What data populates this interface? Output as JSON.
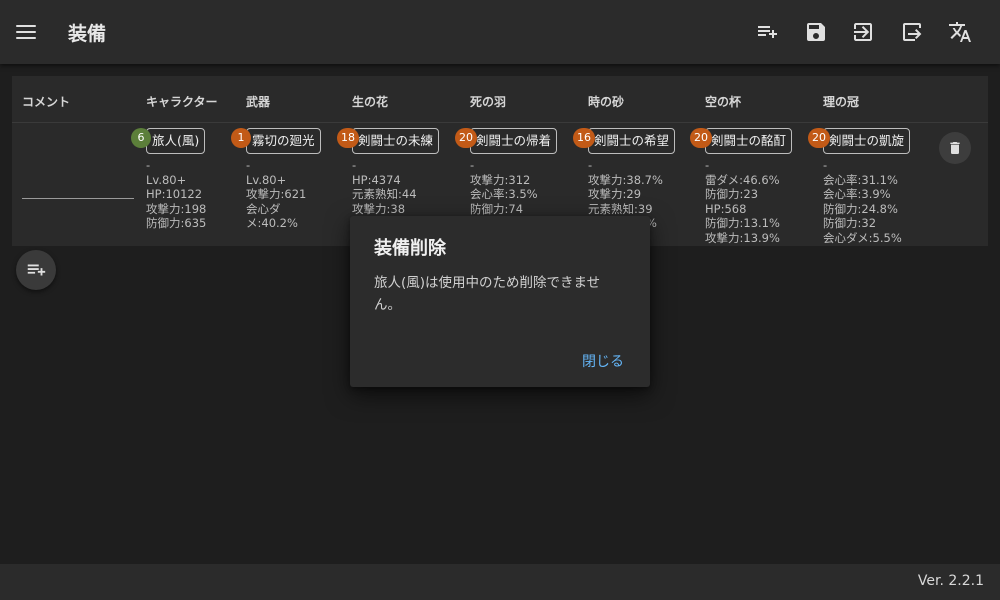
{
  "app": {
    "title": "装備",
    "version": "Ver. 2.2.1"
  },
  "toolbar_icons": [
    "playlist-add-icon",
    "save-icon",
    "import-icon",
    "export-icon",
    "translate-icon"
  ],
  "table": {
    "headers": [
      "コメント",
      "キャラクター",
      "武器",
      "生の花",
      "死の羽",
      "時の砂",
      "空の杯",
      "理の冠"
    ],
    "row": {
      "comment": "",
      "character": {
        "badge": "6",
        "name": "旅人(風)",
        "stats": [
          "-",
          "Lv.80+",
          "HP:10122",
          "攻撃力:198",
          "防御力:635"
        ]
      },
      "weapon": {
        "badge": "1",
        "name": "霧切の廻光",
        "stats": [
          "-",
          "Lv.80+",
          "攻撃力:621",
          "会心ダ",
          "メ:40.2%"
        ]
      },
      "flower": {
        "badge": "18",
        "name": "剣闘士の未練",
        "stats": [
          "-",
          "HP:4374",
          "元素熟知:44",
          "攻撃力:38"
        ]
      },
      "plume": {
        "badge": "20",
        "name": "剣闘士の帰着",
        "stats": [
          "-",
          "攻撃力:312",
          "会心率:3.5%",
          "防御力:74"
        ]
      },
      "sands": {
        "badge": "16",
        "name": "剣闘士の希望",
        "stats": [
          "-",
          "攻撃力:38.7%",
          "攻撃力:29",
          "元素熟知:39"
        ]
      },
      "goblet": {
        "badge": "20",
        "name": "剣闘士の酩酊",
        "stats": [
          "-",
          "雷ダメ:46.6%",
          "防御力:23",
          "HP:568",
          "防御力:13.1%",
          "攻撃力:13.9%"
        ]
      },
      "circlet": {
        "badge": "20",
        "name": "剣闘士の凱旋",
        "stats": [
          "-",
          "会心率:31.1%",
          "会心率:3.9%",
          "防御力:24.8%",
          "防御力:32",
          "会心ダメ:5.5%"
        ]
      }
    },
    "partial_hidden_text": "%"
  },
  "dialog": {
    "title": "装備削除",
    "message": "旅人(風)は使用中のため削除できません。",
    "close_label": "閉じる"
  },
  "colors": {
    "badge_green": "#5c7f3a",
    "badge_orange": "#c25a17",
    "link_blue": "#64b5f6"
  }
}
